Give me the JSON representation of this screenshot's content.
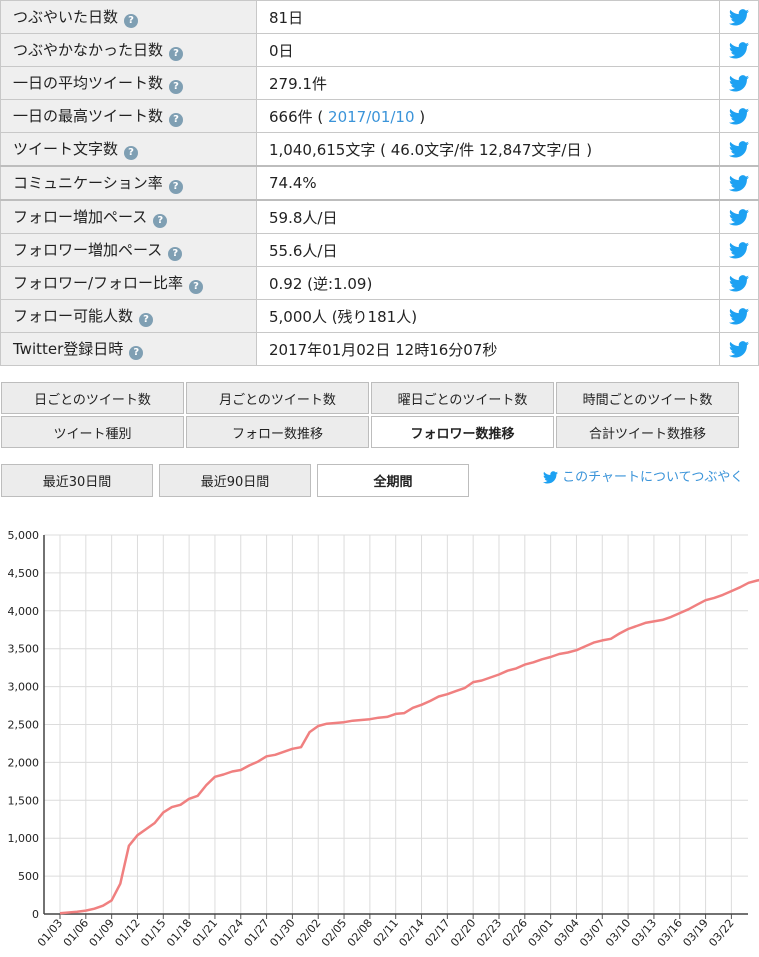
{
  "stats": [
    {
      "label": "つぶやいた日数",
      "value": "81日"
    },
    {
      "label": "つぶやかなかった日数",
      "value": "0日"
    },
    {
      "label": "一日の平均ツイート数",
      "value": "279.1件"
    },
    {
      "label": "一日の最高ツイート数",
      "value": "666件 (",
      "link": "2017/01/10",
      "value_after": ")"
    },
    {
      "label": "ツイート文字数",
      "value": "1,040,615文字 ( 46.0文字/件 12,847文字/日 )"
    },
    {
      "label": "コミュニケーション率",
      "value": "74.4%"
    },
    {
      "label": "フォロー増加ペース",
      "value": "59.8人/日"
    },
    {
      "label": "フォロワー増加ペース",
      "value": "55.6人/日"
    },
    {
      "label": "フォロワー/フォロー比率",
      "value": "0.92 (逆:1.09)"
    },
    {
      "label": "フォロー可能人数",
      "value": "5,000人 (残り181人)"
    },
    {
      "label": "Twitter登録日時",
      "value": "2017年01月02日 12時16分07秒"
    }
  ],
  "help_glyph": "?",
  "tabs_row1": [
    "日ごとのツイート数",
    "月ごとのツイート数",
    "曜日ごとのツイート数",
    "時間ごとのツイート数"
  ],
  "tabs_row2": [
    "ツイート種別",
    "フォロー数推移",
    "フォロワー数推移",
    "合計ツイート数推移"
  ],
  "active_tab": "フォロワー数推移",
  "periods": [
    "最近30日間",
    "最近90日間",
    "全期間"
  ],
  "active_period": "全期間",
  "share_text": "このチャートについてつぶやく",
  "colors": {
    "line": "#f08080",
    "twitter": "#1da1f2",
    "link": "#3b94d9"
  },
  "chart_data": {
    "type": "line",
    "ylim": [
      0,
      5000
    ],
    "yticks": [
      "0",
      "500",
      "1,000",
      "1,500",
      "2,000",
      "2,500",
      "3,000",
      "3,500",
      "4,000",
      "4,500",
      "5,000"
    ],
    "xticks": [
      "01/03",
      "01/06",
      "01/09",
      "01/12",
      "01/15",
      "01/18",
      "01/21",
      "01/24",
      "01/27",
      "01/30",
      "02/02",
      "02/05",
      "02/08",
      "02/11",
      "02/14",
      "02/17",
      "02/20",
      "02/23",
      "02/26",
      "03/01",
      "03/04",
      "03/07",
      "03/10",
      "03/13",
      "03/16",
      "03/19",
      "03/22"
    ],
    "x": [
      "01/03",
      "01/04",
      "01/05",
      "01/06",
      "01/07",
      "01/08",
      "01/09",
      "01/10",
      "01/11",
      "01/12",
      "01/13",
      "01/14",
      "01/15",
      "01/16",
      "01/17",
      "01/18",
      "01/19",
      "01/20",
      "01/21",
      "01/22",
      "01/23",
      "01/24",
      "01/25",
      "01/26",
      "01/27",
      "01/28",
      "01/29",
      "01/30",
      "01/31",
      "02/01",
      "02/02",
      "02/03",
      "02/04",
      "02/05",
      "02/06",
      "02/07",
      "02/08",
      "02/09",
      "02/10",
      "02/11",
      "02/12",
      "02/13",
      "02/14",
      "02/15",
      "02/16",
      "02/17",
      "02/18",
      "02/19",
      "02/20",
      "02/21",
      "02/22",
      "02/23",
      "02/24",
      "02/25",
      "02/26",
      "02/27",
      "02/28",
      "03/01",
      "03/02",
      "03/03",
      "03/04",
      "03/05",
      "03/06",
      "03/07",
      "03/08",
      "03/09",
      "03/10",
      "03/11",
      "03/12",
      "03/13",
      "03/14",
      "03/15",
      "03/16",
      "03/17",
      "03/18",
      "03/19",
      "03/20",
      "03/21",
      "03/22",
      "03/23"
    ],
    "values": [
      10,
      20,
      30,
      45,
      70,
      110,
      180,
      400,
      900,
      1040,
      1120,
      1200,
      1340,
      1410,
      1440,
      1520,
      1560,
      1700,
      1810,
      1840,
      1880,
      1900,
      1960,
      2010,
      2080,
      2100,
      2140,
      2180,
      2200,
      2400,
      2480,
      2510,
      2520,
      2530,
      2550,
      2560,
      2570,
      2590,
      2600,
      2640,
      2650,
      2720,
      2760,
      2810,
      2870,
      2900,
      2940,
      2980,
      3060,
      3080,
      3120,
      3160,
      3210,
      3240,
      3290,
      3320,
      3360,
      3390,
      3430,
      3450,
      3480,
      3530,
      3580,
      3610,
      3630,
      3700,
      3760,
      3800,
      3840,
      3860,
      3880,
      3920,
      3970,
      4020,
      4080,
      4140,
      4170,
      4210,
      4260,
      4310,
      4370,
      4400,
      4420
    ]
  }
}
